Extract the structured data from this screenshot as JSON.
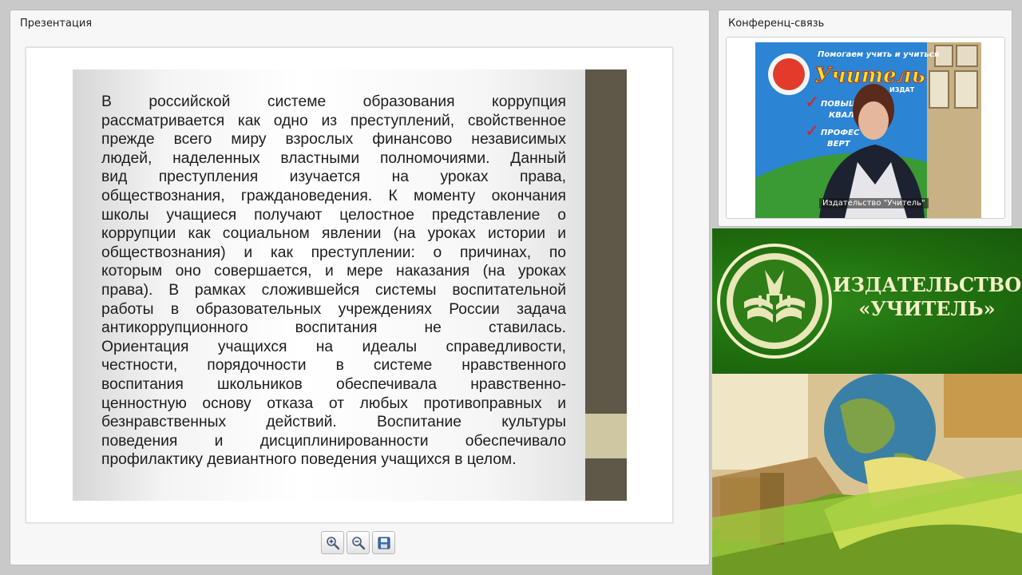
{
  "presentation": {
    "title": "Презентация",
    "slide_lines": [
      "В российской системе образования коррупция",
      "рассматривается как одно из преступлений, свойственное",
      "прежде всего миру взрослых финансово независимых",
      "людей, наделенных властными полномочиями. Данный",
      "вид преступления изучается на уроках права,",
      "обществознания, граждановедения. К моменту окончания",
      "школы учащиеся получают целостное представление о",
      "коррупции как социальном явлении (на уроках истории и",
      "обществознания) и как преступлении: о причинах, по",
      "которым оно совершается, и мере наказания (на уроках",
      "права). В рамках сложившейся системы воспитательной",
      "работы в образовательных учреждениях России задача",
      "антикоррупционного воспитания не ставилась.",
      "Ориентация учащихся на идеалы справедливости,",
      "честности, порядочности в системе нравственного",
      "воспитания школьников обеспечивала нравственно-",
      "ценностную основу отказа от любых противоправных и",
      "безнравственных действий. Воспитание культуры",
      "поведения и дисциплинированности обеспечивало",
      "профилактику девиантного поведения учащихся в целом."
    ],
    "toolbar": {
      "zoom_in_icon": "zoom-in-icon",
      "zoom_out_icon": "zoom-out-icon",
      "save_icon": "save-icon"
    },
    "colors": {
      "slide_bar": "#5e5848",
      "slide_bar_accent": "#cfc7a2"
    }
  },
  "conference": {
    "title": "Конференц-связь",
    "video_caption": "Издательство \"Учитель\"",
    "backdrop_text": [
      "Помогаем учить и учиться",
      "Учитель",
      "ИЗДАТ",
      "ПОВЫШЕ",
      "КВАЛ",
      "ПРОФЕС",
      "ВЕРТ"
    ]
  },
  "banner": {
    "line1": "ИЗДАТЕЛЬСТВО",
    "line2": "«УЧИТЕЛЬ»",
    "colors": {
      "green": "#1f6e0f",
      "text": "#f3f0c8"
    }
  }
}
